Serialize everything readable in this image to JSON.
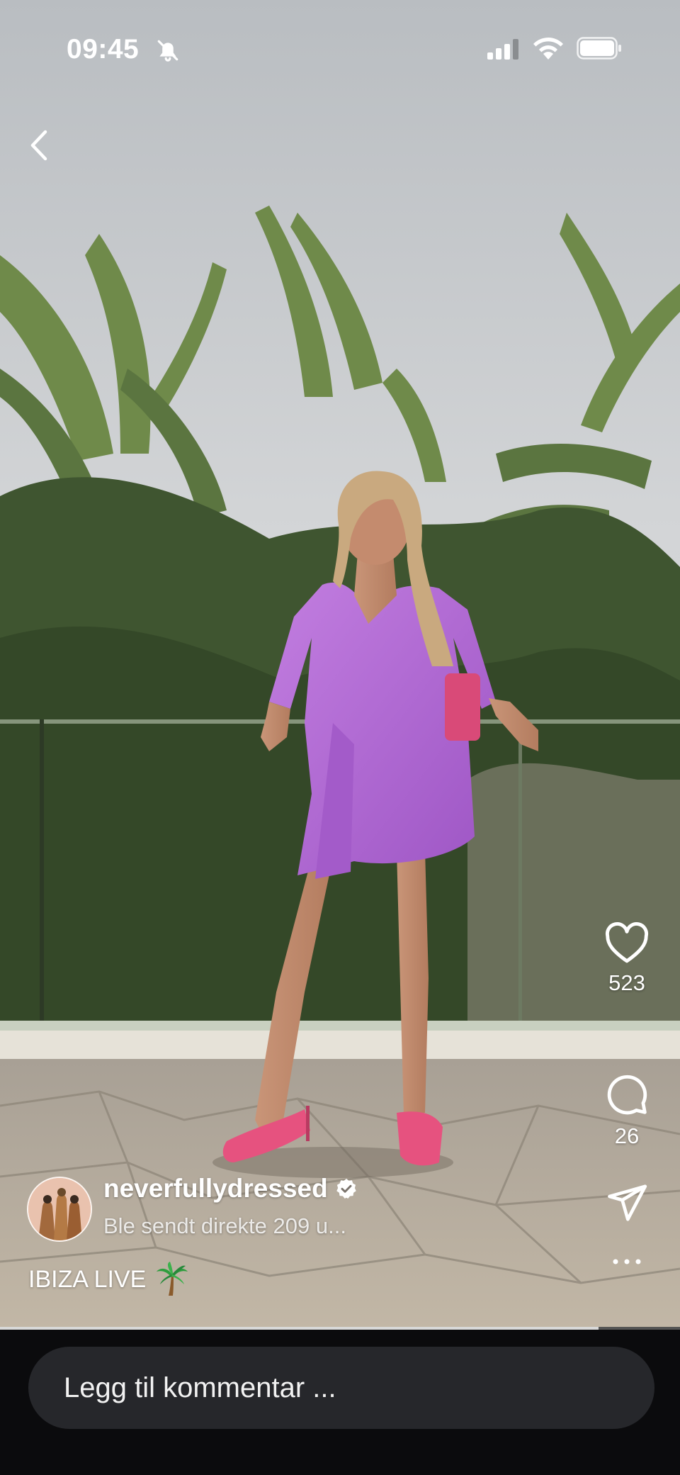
{
  "status_bar": {
    "time": "09:45",
    "silent_icon": "bell-slash-icon",
    "signal_icon": "cellular-signal-icon",
    "wifi_icon": "wifi-icon",
    "battery_icon": "battery-icon"
  },
  "nav": {
    "back_icon": "chevron-left-icon"
  },
  "actions": {
    "likes": "523",
    "comments": "26",
    "like_icon": "heart-icon",
    "comment_icon": "comment-bubble-icon",
    "share_icon": "paper-plane-icon",
    "more_icon": "more-dots-icon"
  },
  "post": {
    "username": "neverfullydressed",
    "verified_icon": "verified-badge-icon",
    "subtitle": "Ble sendt direkte 209 u...",
    "caption": "IBIZA LIVE",
    "caption_emoji": "palm-tree-icon"
  },
  "progress": {
    "fraction": 0.88
  },
  "composer": {
    "placeholder": "Legg til kommentar ..."
  },
  "colors": {
    "accent": "#ffffff",
    "bar_bg": "#0b0b0d",
    "input_bg": "#26272b",
    "dress": "#b36ad6",
    "shoes": "#e6527f"
  }
}
